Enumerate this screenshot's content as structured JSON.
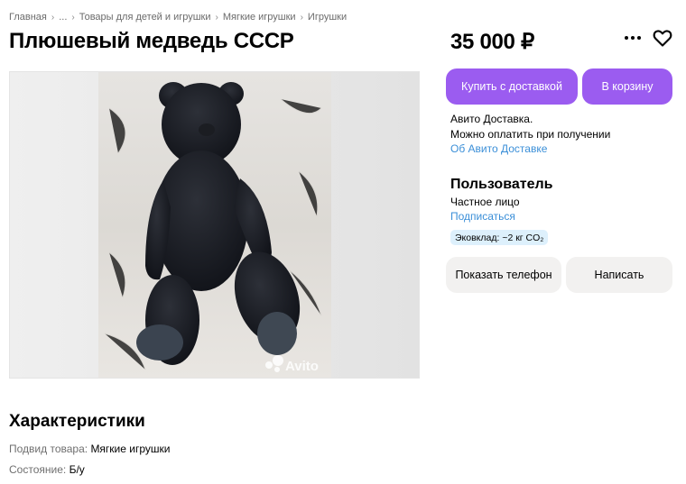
{
  "breadcrumbs": [
    "Главная",
    "...",
    "Товары для детей и игрушки",
    "Мягкие игрушки",
    "Игрушки"
  ],
  "title": "Плюшевый медведь СССР",
  "price": "35 000 ₽",
  "buttons": {
    "buy_delivery": "Купить с доставкой",
    "to_cart": "В корзину",
    "show_phone": "Показать телефон",
    "write": "Написать"
  },
  "delivery": {
    "line1": "Авито Доставка.",
    "line2": "Можно оплатить при получении",
    "link": "Об Авито Доставке"
  },
  "seller": {
    "name": "Пользователь",
    "type": "Частное лицо",
    "subscribe": "Подписаться",
    "eco_badge": "Эковклад: ~2 кг CO₂"
  },
  "photo": {
    "watermark": "Avito",
    "subject_icon": "teddy-bear-photo"
  },
  "characteristics": {
    "title": "Характеристики",
    "rows": [
      {
        "key": "Подвид товара:",
        "value": "Мягкие игрушки"
      },
      {
        "key": "Состояние:",
        "value": "Б/у"
      }
    ]
  },
  "icons": {
    "more": "more-horizontal-icon",
    "favorite": "heart-outline-icon"
  },
  "colors": {
    "accent": "#9b5cf0",
    "link": "#3b8fd8",
    "secondary_button": "#f2f1f0",
    "eco_badge_bg": "#ddf0fc"
  }
}
